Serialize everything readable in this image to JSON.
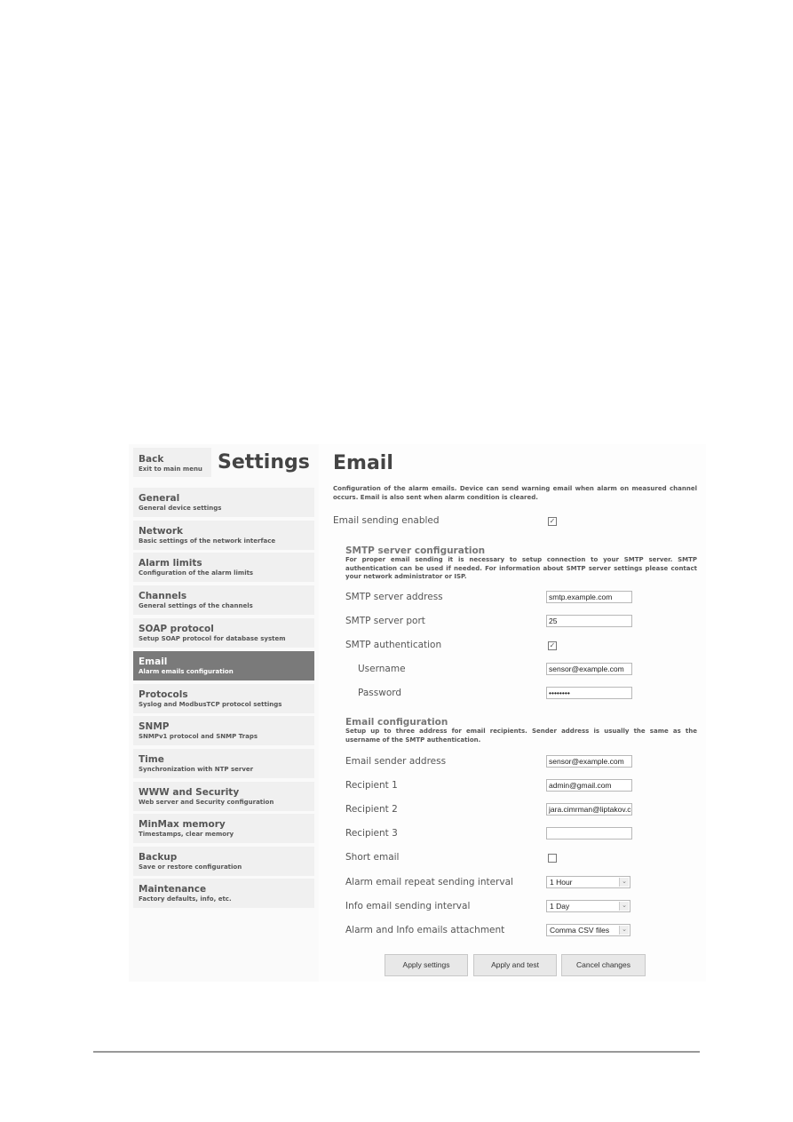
{
  "sidebar": {
    "back": {
      "title": "Back",
      "subtitle": "Exit to main menu"
    },
    "title": "Settings",
    "items": [
      {
        "title": "General",
        "subtitle": "General device settings"
      },
      {
        "title": "Network",
        "subtitle": "Basic settings of the network interface"
      },
      {
        "title": "Alarm limits",
        "subtitle": "Configuration of the alarm limits"
      },
      {
        "title": "Channels",
        "subtitle": "General settings of the channels"
      },
      {
        "title": "SOAP protocol",
        "subtitle": "Setup SOAP protocol for database system"
      },
      {
        "title": "Email",
        "subtitle": "Alarm emails configuration",
        "active": true
      },
      {
        "title": "Protocols",
        "subtitle": "Syslog and ModbusTCP protocol settings"
      },
      {
        "title": "SNMP",
        "subtitle": "SNMPv1 protocol and SNMP Traps"
      },
      {
        "title": "Time",
        "subtitle": "Synchronization with NTP server"
      },
      {
        "title": "WWW and Security",
        "subtitle": "Web server and Security configuration"
      },
      {
        "title": "MinMax memory",
        "subtitle": "Timestamps, clear memory"
      },
      {
        "title": "Backup",
        "subtitle": "Save or restore configuration"
      },
      {
        "title": "Maintenance",
        "subtitle": "Factory defaults, info, etc."
      }
    ]
  },
  "main": {
    "title": "Email",
    "intro": "Configuration of the alarm emails. Device can send warning email when alarm on measured channel occurs. Email is also sent when alarm condition is cleared.",
    "email_enabled": {
      "label": "Email sending enabled",
      "checked": true,
      "mark": "✓"
    },
    "smtp": {
      "title": "SMTP server configuration",
      "desc": "For proper email sending it is necessary to setup connection to your SMTP server. SMTP authentication can be used if needed. For information about SMTP server settings please contact your network administrator or ISP.",
      "address": {
        "label": "SMTP server address",
        "value": "smtp.example.com"
      },
      "port": {
        "label": "SMTP server port",
        "value": "25"
      },
      "auth": {
        "label": "SMTP authentication",
        "checked": true,
        "mark": "✓"
      },
      "username": {
        "label": "Username",
        "value": "sensor@example.com"
      },
      "password": {
        "label": "Password",
        "value": "••••••••"
      }
    },
    "email_config": {
      "title": "Email configuration",
      "desc": "Setup up to three address for email recipients. Sender address is usually the same as the username of the SMTP authentication.",
      "sender": {
        "label": "Email sender address",
        "value": "sensor@example.com"
      },
      "recipient1": {
        "label": "Recipient 1",
        "value": "admin@gmail.com"
      },
      "recipient2": {
        "label": "Recipient 2",
        "value": "jara.cimrman@liptakov.c"
      },
      "recipient3": {
        "label": "Recipient 3",
        "value": ""
      },
      "short_email": {
        "label": "Short email",
        "checked": false,
        "mark": ""
      },
      "alarm_interval": {
        "label": "Alarm email repeat sending interval",
        "value": "1 Hour"
      },
      "info_interval": {
        "label": "Info email sending interval",
        "value": "1 Day"
      },
      "attachment": {
        "label": "Alarm and Info emails attachment",
        "value": "Comma CSV files"
      }
    },
    "buttons": {
      "apply": "Apply settings",
      "apply_test": "Apply and test",
      "cancel": "Cancel changes"
    },
    "icons": {
      "dropdown": "⌄"
    }
  }
}
